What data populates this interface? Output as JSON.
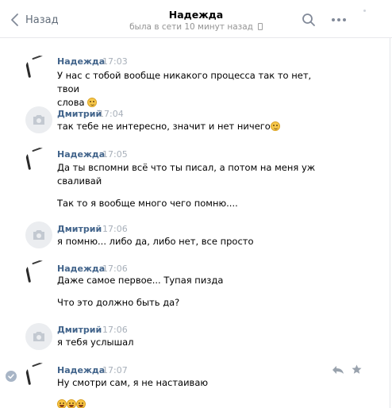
{
  "header": {
    "back_label": "Назад",
    "contact_name": "Надежда",
    "status": "была в сети 10 минут назад"
  },
  "partial_text": "~ ~ ~ ~ ~ ~ ~ ~ ~ ~ ~ ~",
  "messages": [
    {
      "author": "Надежда",
      "time": "17:03",
      "lines": [
        "У нас с тобой вообще никакого процесса так то нет, твои",
        "слова"
      ],
      "emoji": true
    },
    {
      "author": "Дмитрий",
      "time": "17:04",
      "lines": [
        "так тебе не интересно, значит и нет ничего"
      ],
      "emoji": true
    },
    {
      "author": "Надежда",
      "time": "17:05",
      "lines": [
        "Да ты вспомни всё что ты писал, а потом на меня уж",
        "сваливай",
        "Так то я вообще много чего помню...."
      ]
    },
    {
      "author": "Дмитрий",
      "time": "17:06",
      "lines": [
        "я помню... либо да, либо нет, все просто"
      ]
    },
    {
      "author": "Надежда",
      "time": "17:06",
      "lines": [
        "Даже самое первое... Тупая пизда",
        "Что это должно быть да?"
      ]
    },
    {
      "author": "Дмитрий",
      "time": "17:06",
      "lines": [
        "я тебя услышал"
      ]
    },
    {
      "author": "Надежда",
      "time": "17:07",
      "lines": [
        "Ну смотри сам, я не настаиваю"
      ],
      "emoji_count": 3
    }
  ],
  "colors": {
    "author": "#42648b",
    "time": "#a8b0ba",
    "status": "#939393",
    "accent": "#5181b8"
  }
}
